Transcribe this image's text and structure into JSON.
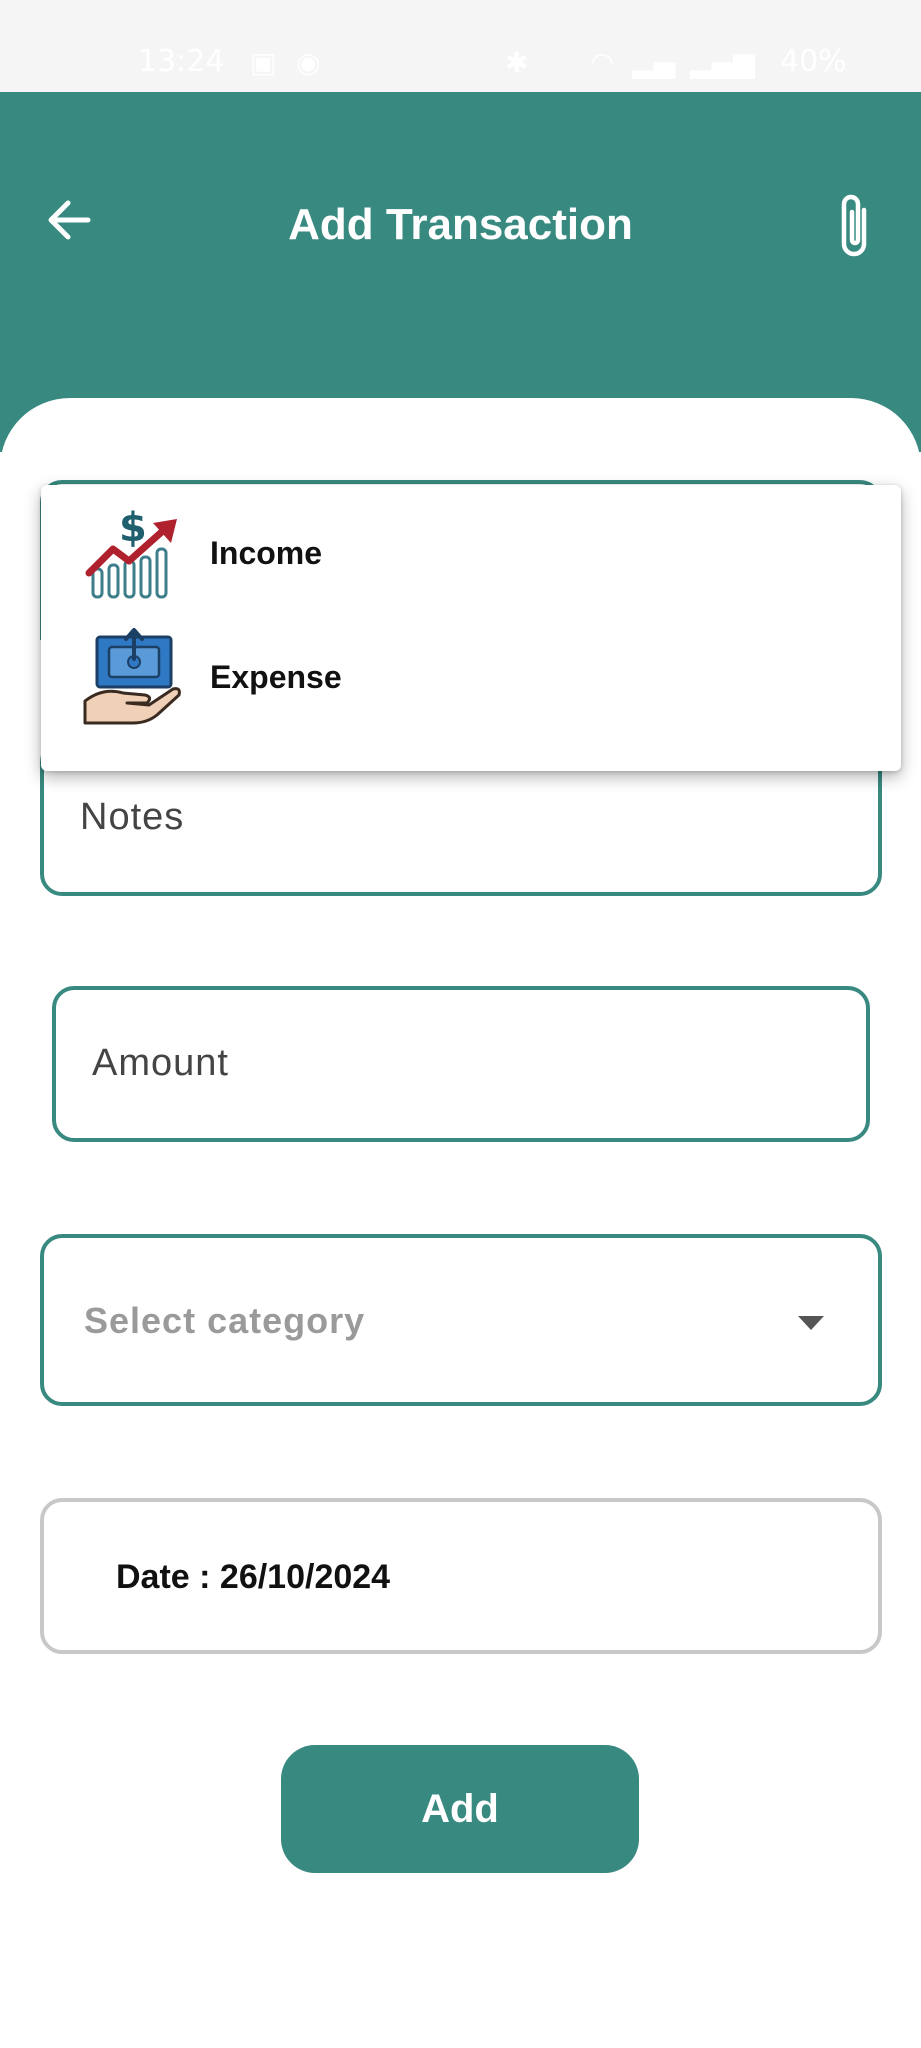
{
  "status_bar": {
    "time": "13:24",
    "battery": "40%"
  },
  "header": {
    "title": "Add Transaction"
  },
  "type_menu": {
    "options": [
      {
        "label": "Income",
        "icon": "income-chart-icon"
      },
      {
        "label": "Expense",
        "icon": "expense-hand-icon"
      }
    ]
  },
  "form": {
    "notes_placeholder": "Notes",
    "amount_placeholder": "Amount",
    "category_placeholder": "Select category",
    "date_text": "Date : 26/10/2024"
  },
  "actions": {
    "add_label": "Add"
  },
  "colors": {
    "primary": "#388a80",
    "background": "#ffffff"
  }
}
